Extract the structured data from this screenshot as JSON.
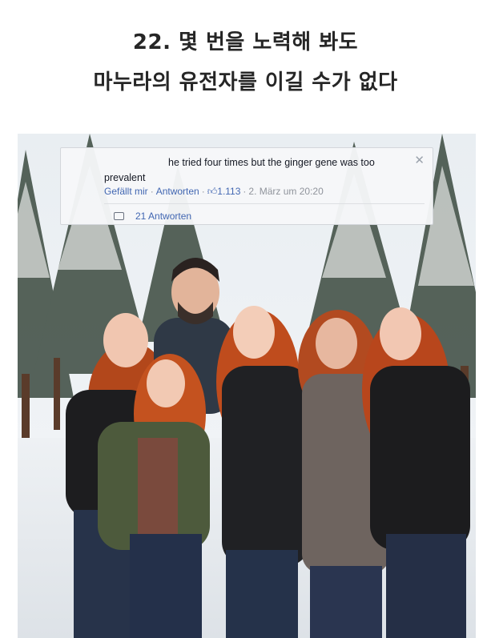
{
  "heading": {
    "line1": "22. 몇 번을 노력해 봐도",
    "line2": "마누라의 유전자를 이길 수가 없다"
  },
  "comment": {
    "text_line1": "he tried four times but the ginger gene was too",
    "text_line2": "prevalent",
    "like_label": "Gefällt mir",
    "separator": "·",
    "reply_label": "Antworten",
    "like_icon": "thumbs-up-icon",
    "like_count": "1.113",
    "date": "2. März um 20:20",
    "replies": "21 Antworten",
    "close_icon": "close-icon"
  },
  "photo": {
    "subject": "family-photo"
  }
}
